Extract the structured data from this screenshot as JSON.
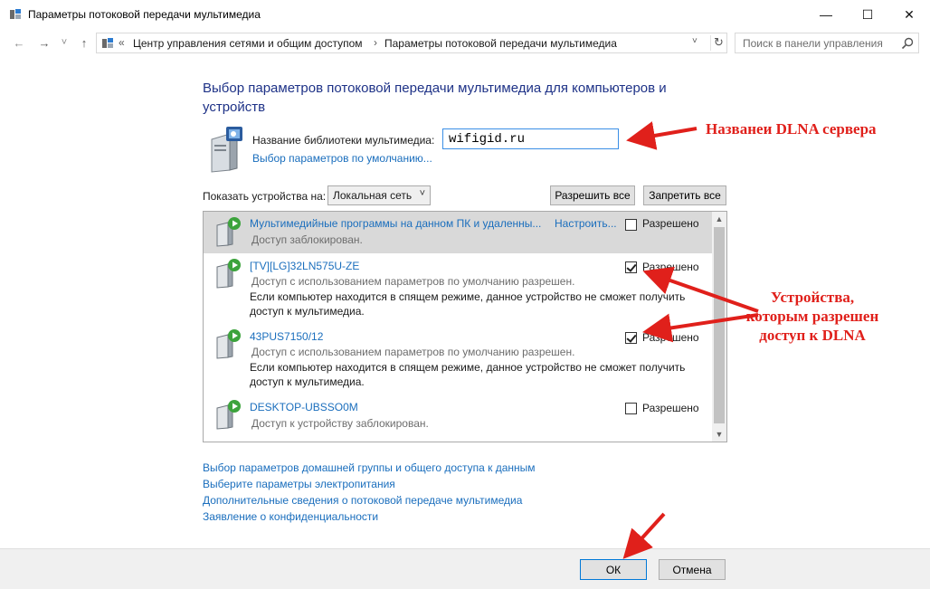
{
  "window": {
    "title": "Параметры потоковой передачи мультимедиа",
    "minimize": "—",
    "maximize": "☐",
    "close": "✕"
  },
  "nav": {
    "back": "←",
    "forward": "→",
    "history": "˅",
    "up": "↑",
    "breadcrumb_sep": "«",
    "breadcrumbs": [
      "Центр управления сетями и общим доступом",
      "Параметры потоковой передачи мультимедиа"
    ],
    "crumb_arrow": "›",
    "dropdown": "˅",
    "refresh": "↻",
    "search_placeholder": "Поиск в панели управления"
  },
  "main": {
    "heading": "Выбор параметров потоковой передачи мультимедиа для компьютеров и устройств",
    "library_label": "Название библиотеки мультимедиа:",
    "library_value": "wifigid.ru",
    "library_default_link": "Выбор параметров по умолчанию...",
    "show_devices_label": "Показать устройства на:",
    "show_devices_value": "Локальная сеть",
    "allow_all": "Разрешить все",
    "deny_all": "Запретить все"
  },
  "devices": [
    {
      "name": "Мультимедийные программы на данном ПК и удаленны...",
      "status": "Доступ заблокирован.",
      "configure": "Настроить...",
      "allowed_label": "Разрешено",
      "checked": false,
      "selected": true
    },
    {
      "name": "[TV][LG]32LN575U-ZE",
      "status": "Доступ с использованием параметров по умолчанию разрешен.",
      "note": "Если компьютер находится в спящем режиме, данное устройство не сможет получить доступ к мультимедиа.",
      "allowed_label": "Разрешено",
      "checked": true
    },
    {
      "name": "43PUS7150/12",
      "status": "Доступ с использованием параметров по умолчанию разрешен.",
      "note": "Если компьютер находится в спящем режиме, данное устройство не сможет получить доступ к мультимедиа.",
      "allowed_label": "Разрешено",
      "checked": true
    },
    {
      "name": "DESKTOP-UBSSO0M",
      "status": "Доступ к устройству заблокирован.",
      "allowed_label": "Разрешено",
      "checked": false
    }
  ],
  "scroll": {
    "up": "▲",
    "down": "▼"
  },
  "links": [
    "Выбор параметров домашней группы и общего доступа к данным",
    "Выберите параметры электропитания",
    "Дополнительные сведения о потоковой передаче мультимедиа",
    "Заявление о конфиденциальности"
  ],
  "footer": {
    "ok": "ОК",
    "cancel": "Отмена"
  },
  "annotations": {
    "server_name": "Названеи DLNA сервера",
    "allowed_devices": "Устройства, которым разрешен доступ к DLNA"
  },
  "colors": {
    "heading": "#1e3287",
    "link": "#1a6ebd",
    "annotation": "#e0201b",
    "input_focus": "#3a8ee6"
  }
}
